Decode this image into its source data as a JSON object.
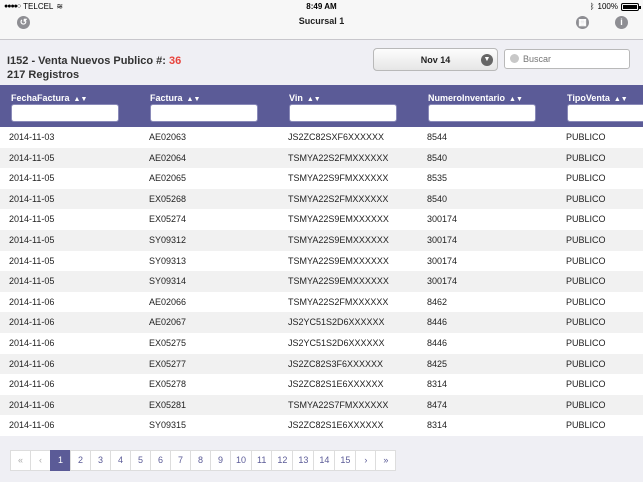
{
  "status_bar": {
    "carrier": "TELCEL",
    "time": "8:49 AM",
    "battery": "100%"
  },
  "nav": {
    "title": "Sucursal 1",
    "back_icon": "back-icon",
    "grid_icon": "grid-icon",
    "info_icon": "info-icon"
  },
  "header": {
    "title": "I152 - Venta Nuevos Publico #:",
    "title_number": "36",
    "records": "217 Registros",
    "date_selected": "Nov 14",
    "search_placeholder": "Buscar"
  },
  "colors": {
    "accent": "#5b5b97",
    "number": "#e8433c"
  },
  "table": {
    "columns": [
      "FechaFactura",
      "Factura",
      "Vin",
      "NumeroInventario",
      "TipoVenta"
    ],
    "rows": [
      [
        "2014-11-03",
        "AE02063",
        "JS2ZC82SXF6XXXXXX",
        "8544",
        "PUBLICO"
      ],
      [
        "2014-11-05",
        "AE02064",
        "TSMYA22S2FMXXXXXX",
        "8540",
        "PUBLICO"
      ],
      [
        "2014-11-05",
        "AE02065",
        "TSMYA22S9FMXXXXXX",
        "8535",
        "PUBLICO"
      ],
      [
        "2014-11-05",
        "EX05268",
        "TSMYA22S2FMXXXXXX",
        "8540",
        "PUBLICO"
      ],
      [
        "2014-11-05",
        "EX05274",
        "TSMYA22S9EMXXXXXX",
        "300174",
        "PUBLICO"
      ],
      [
        "2014-11-05",
        "SY09312",
        "TSMYA22S9EMXXXXXX",
        "300174",
        "PUBLICO"
      ],
      [
        "2014-11-05",
        "SY09313",
        "TSMYA22S9EMXXXXXX",
        "300174",
        "PUBLICO"
      ],
      [
        "2014-11-05",
        "SY09314",
        "TSMYA22S9EMXXXXXX",
        "300174",
        "PUBLICO"
      ],
      [
        "2014-11-06",
        "AE02066",
        "TSMYA22S2FMXXXXXX",
        "8462",
        "PUBLICO"
      ],
      [
        "2014-11-06",
        "AE02067",
        "JS2YC51S2D6XXXXXX",
        "8446",
        "PUBLICO"
      ],
      [
        "2014-11-06",
        "EX05275",
        "JS2YC51S2D6XXXXXX",
        "8446",
        "PUBLICO"
      ],
      [
        "2014-11-06",
        "EX05277",
        "JS2ZC82S3F6XXXXXX",
        "8425",
        "PUBLICO"
      ],
      [
        "2014-11-06",
        "EX05278",
        "JS2ZC82S1E6XXXXXX",
        "8314",
        "PUBLICO"
      ],
      [
        "2014-11-06",
        "EX05281",
        "TSMYA22S7FMXXXXXX",
        "8474",
        "PUBLICO"
      ],
      [
        "2014-11-06",
        "SY09315",
        "JS2ZC82S1E6XXXXXX",
        "8314",
        "PUBLICO"
      ]
    ]
  },
  "pagination": {
    "first": "«",
    "prev": "‹",
    "pages": [
      "1",
      "2",
      "3",
      "4",
      "5",
      "6",
      "7",
      "8",
      "9",
      "10",
      "11",
      "12",
      "13",
      "14",
      "15"
    ],
    "active": "1",
    "next": "›",
    "last": "»"
  }
}
